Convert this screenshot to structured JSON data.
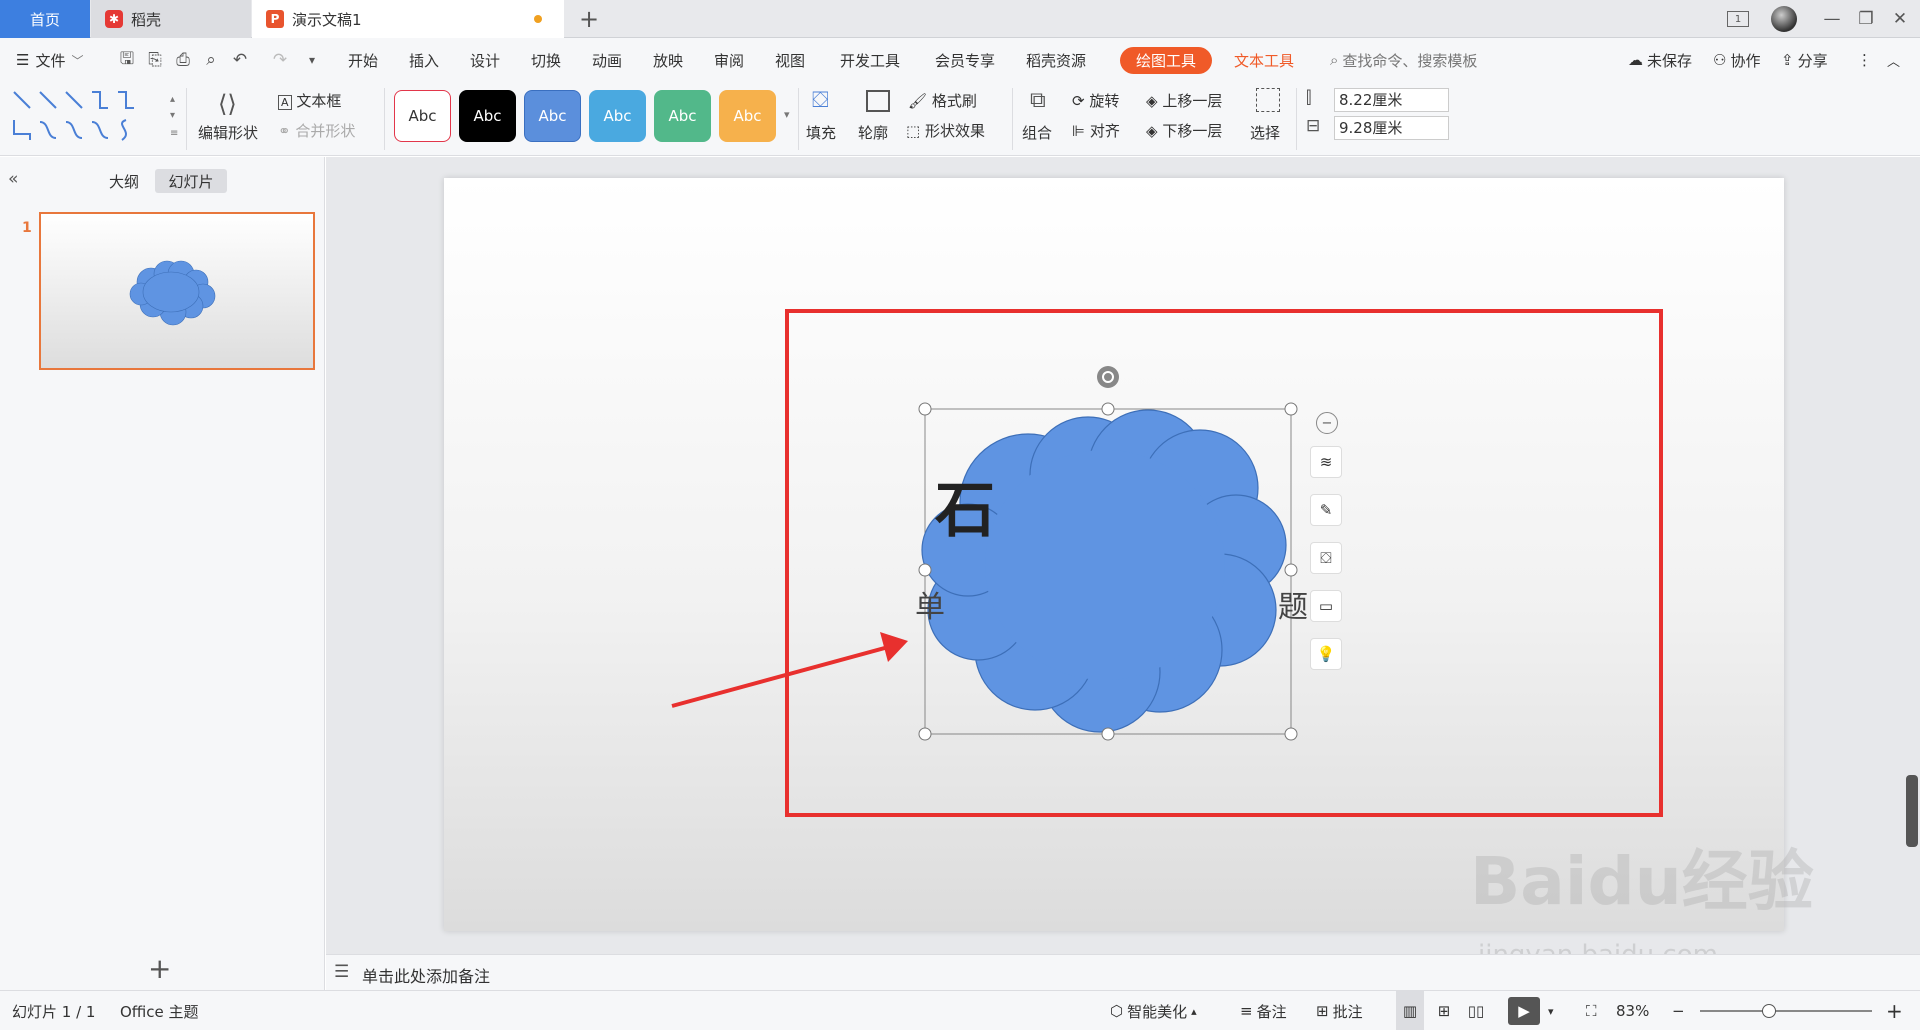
{
  "tabs": {
    "home": "首页",
    "docer": "稻壳",
    "document": "演示文稿1",
    "add": "+"
  },
  "window": {
    "pages_indicator": "1",
    "minimize": "—",
    "restore": "❐",
    "close": "✕"
  },
  "menu": {
    "file": "文件",
    "items": [
      "开始",
      "插入",
      "设计",
      "切换",
      "动画",
      "放映",
      "审阅",
      "视图",
      "开发工具",
      "会员专享",
      "稻壳资源"
    ],
    "drawing_tools": "绘图工具",
    "text_tools": "文本工具",
    "search_placeholder": "查找命令、搜索模板",
    "unsaved": "未保存",
    "collaborate": "协作",
    "share": "分享"
  },
  "ribbon": {
    "edit_shape": "编辑形状",
    "text_box": "文本框",
    "merge_shapes": "合并形状",
    "style_label": "Abc",
    "styles": [
      {
        "bg": "#ffffff",
        "fg": "#333333",
        "border": "#e2364a"
      },
      {
        "bg": "#000000",
        "fg": "#ffffff",
        "border": "#000000"
      },
      {
        "bg": "#5b8fdc",
        "fg": "#ffffff",
        "border": "#3a6fc0"
      },
      {
        "bg": "#4aa9e0",
        "fg": "#ffffff",
        "border": "#2e8fc8"
      },
      {
        "bg": "#52b88a",
        "fg": "#ffffff",
        "border": "#3a9a70"
      },
      {
        "bg": "#f6b14c",
        "fg": "#ffffff",
        "border": "#e09a30"
      }
    ],
    "fill": "填充",
    "outline": "轮廓",
    "format_painter": "格式刷",
    "shape_effects": "形状效果",
    "group": "组合",
    "rotate": "旋转",
    "align": "对齐",
    "bring_forward": "上移一层",
    "send_backward": "下移一层",
    "select": "选择",
    "height": "8.22厘米",
    "width": "9.28厘米"
  },
  "left_panel": {
    "outline_tab": "大纲",
    "slides_tab": "幻灯片",
    "slide_number": "1",
    "add_slide": "+"
  },
  "slide": {
    "title_partial": "石",
    "subtitle_left": "单",
    "subtitle_right": "题",
    "cloud_color": "#5f94e2",
    "annotation_color": "#e8302e"
  },
  "notes": {
    "placeholder": "单击此处添加备注"
  },
  "status": {
    "slide_count": "幻灯片 1 / 1",
    "theme": "Office 主题",
    "smart_beautify": "智能美化",
    "notes": "备注",
    "comments": "批注",
    "zoom": "83%"
  },
  "watermark": {
    "brand": "Baidu经验",
    "url": "jingyan.baidu.com"
  }
}
